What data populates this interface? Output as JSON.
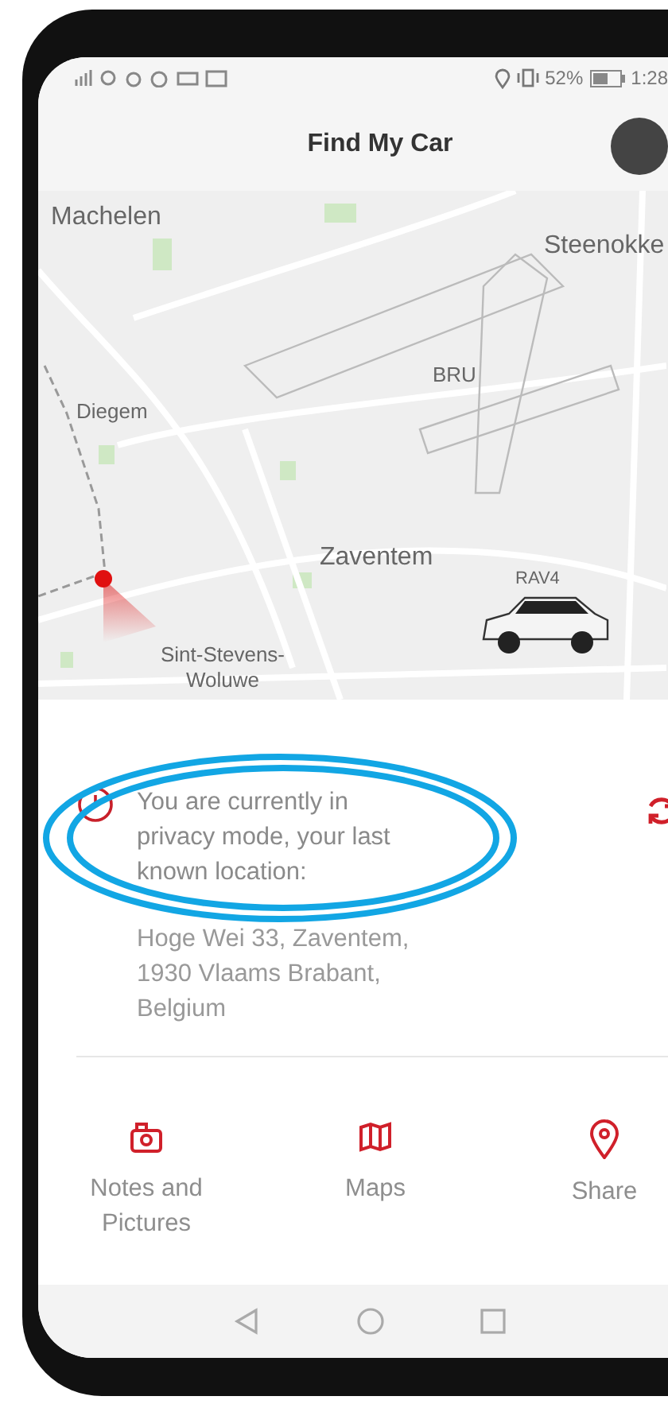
{
  "status_bar": {
    "battery": "52%",
    "time": "1:28"
  },
  "header": {
    "title": "Find My Car"
  },
  "map": {
    "labels": [
      {
        "text": "Machelen"
      },
      {
        "text": "Steenokke"
      },
      {
        "text": "BRU"
      },
      {
        "text": "Diegem"
      },
      {
        "text": "Zaventem"
      },
      {
        "text": "Sint-Stevens-Woluwe"
      }
    ],
    "car_label": "RAV4"
  },
  "privacy": {
    "message": "You are currently in privacy mode, your last known location:",
    "address": "Hoge Wei 33, Zaventem, 1930 Vlaams Brabant, Belgium"
  },
  "actions": [
    {
      "kind": "notes",
      "label": "Notes and Pictures"
    },
    {
      "kind": "maps",
      "label": "Maps"
    },
    {
      "kind": "share",
      "label": "Share"
    }
  ]
}
